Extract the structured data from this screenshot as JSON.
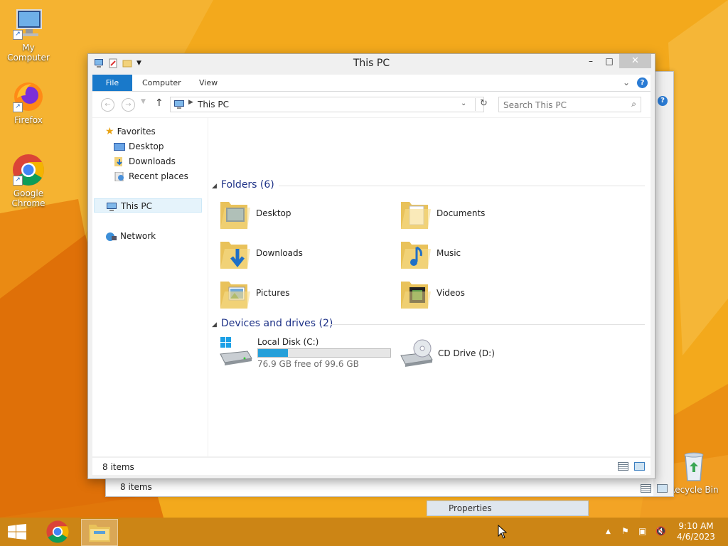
{
  "desktop": {
    "icons": [
      {
        "label": "My Computer",
        "icon": "computer-icon"
      },
      {
        "label": "Firefox",
        "icon": "firefox-icon"
      },
      {
        "label": "Google Chrome",
        "icon": "chrome-icon"
      },
      {
        "label": "Recycle Bin",
        "icon": "recycle-bin-icon"
      }
    ]
  },
  "background_window": {
    "status_text": "8 items",
    "properties_label": "Properties"
  },
  "window": {
    "title": "This PC",
    "controls": {
      "minimize": "–",
      "maximize": "□",
      "close": "✕"
    },
    "ribbon": {
      "tabs": [
        "File",
        "Computer",
        "View"
      ],
      "help": "?"
    },
    "address": {
      "path": "This PC",
      "search_placeholder": "Search This PC"
    },
    "nav_pane": {
      "favorites": "Favorites",
      "favorite_items": [
        "Desktop",
        "Downloads",
        "Recent places"
      ],
      "this_pc": "This PC",
      "network": "Network"
    },
    "folders_header": "Folders (6)",
    "folders": [
      "Desktop",
      "Documents",
      "Downloads",
      "Music",
      "Pictures",
      "Videos"
    ],
    "devices_header": "Devices and drives (2)",
    "drives": [
      {
        "name": "Local Disk (C:)",
        "free_text": "76.9 GB free of 99.6 GB",
        "used_fraction": 0.228
      },
      {
        "name": "CD Drive (D:)"
      }
    ],
    "status_text": "8 items"
  },
  "taskbar": {
    "clock_time": "9:10 AM",
    "clock_date": "4/6/2023"
  },
  "colors": {
    "accent": "#1979ca",
    "wallpaper": "#f3a91c",
    "drive_bar": "#26a0da"
  }
}
